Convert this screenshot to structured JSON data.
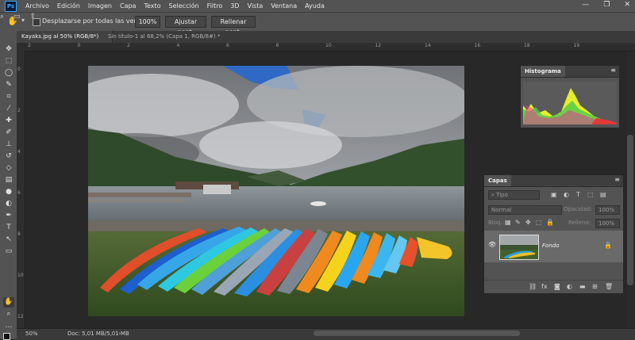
{
  "app": {
    "logo": "Ps",
    "accent": "#31a8ff"
  },
  "menu": [
    "Archivo",
    "Edición",
    "Imagen",
    "Capa",
    "Texto",
    "Selección",
    "Filtro",
    "3D",
    "Vista",
    "Ventana",
    "Ayuda"
  ],
  "window_controls": [
    "—",
    "❐",
    "✕"
  ],
  "options": {
    "scroll_all_label": "Desplazarse por todas las ventanas",
    "zoom_value": "100%",
    "fit_button": "Ajustar pant.",
    "fill_button": "Rellenar pant."
  },
  "tabs": [
    {
      "label": "Kayaks.jpg al 50% (RGB/8*)",
      "close": "×"
    },
    {
      "label": "Sin título-1 al 68,2% (Capa 1, RGB/8#) *",
      "close": "×"
    }
  ],
  "ruler_h": [
    "2",
    "0",
    "2",
    "4",
    "6",
    "8",
    "10",
    "12",
    "14",
    "16",
    "18",
    "19"
  ],
  "ruler_v": [
    "0",
    "2",
    "4",
    "6",
    "8",
    "10",
    "12"
  ],
  "histogram": {
    "title": "Histograma",
    "warning": "▲"
  },
  "layers": {
    "title": "Capas",
    "filter_placeholder": "Tipo",
    "blend_mode": "Normal",
    "opacity_label": "Opacidad:",
    "opacity_value": "100%",
    "lock_label": "Bloq.:",
    "fill_label": "Relleno:",
    "fill_value": "100%",
    "layer_name": "Fondo"
  },
  "status": {
    "zoom": "50%",
    "doc": "Doc: 5,01 MB/5,01 MB"
  }
}
